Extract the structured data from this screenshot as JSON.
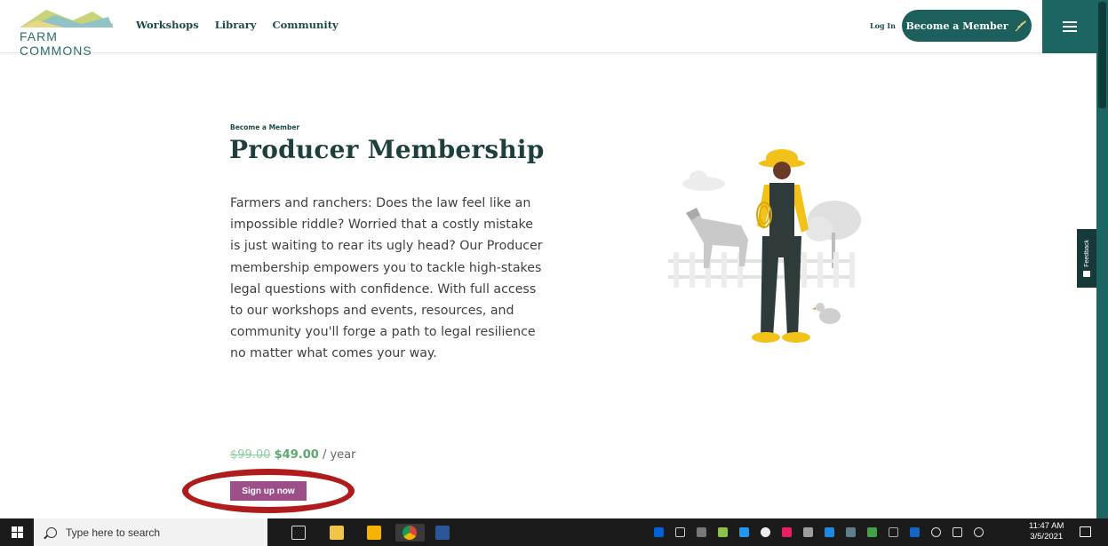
{
  "header": {
    "logo_text": "FARM COMMONS",
    "nav": [
      "Workshops",
      "Library",
      "Community"
    ],
    "login_label": "Log In",
    "member_button_label": "Become a Member"
  },
  "main": {
    "eyebrow": "Become a Member",
    "title": "Producer Membership",
    "description": "Farmers and ranchers: Does the law feel like an impossible riddle? Worried that a costly mistake is just waiting to rear its ugly head? Our Producer membership empowers you to tackle high-stakes legal questions with confidence. With full access to our workshops and events, resources, and community you'll forge a path to legal resilience no matter what comes your way.",
    "price": {
      "original": "$99.00",
      "current": "$49.00",
      "period": "/ year"
    },
    "signup_label": "Sign up now"
  },
  "feedback_label": "Feedback",
  "taskbar": {
    "search_placeholder": "Type here to search",
    "time": "11:47 AM",
    "date": "3/5/2021"
  },
  "colors": {
    "brand_teal": "#1c6562",
    "signup_purple": "#9d4f8a",
    "annotation_red": "#b01c1c",
    "price_green": "#5ba96f"
  }
}
